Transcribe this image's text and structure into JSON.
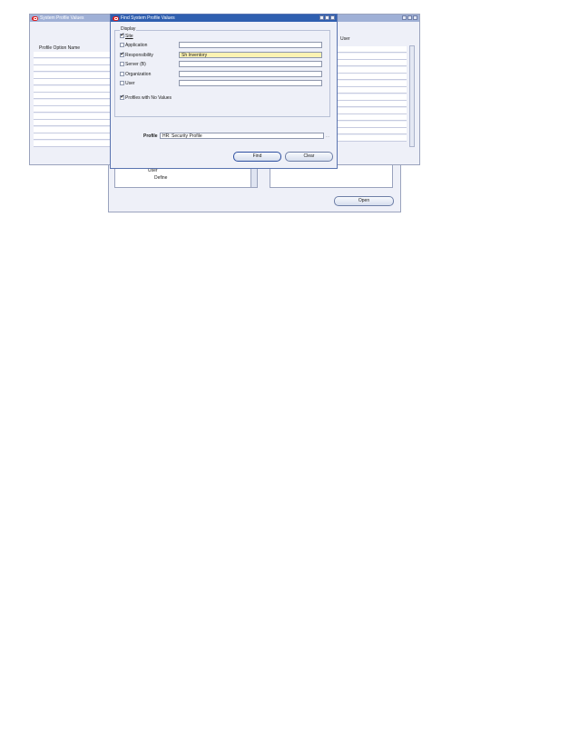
{
  "background_window": {
    "open_label": "Open",
    "tree_items": [
      "User",
      "Define"
    ]
  },
  "profile_values_window": {
    "title": "System Profile Values",
    "column_profile_option_name": "Profile Option Name",
    "column_user": "User"
  },
  "find_window": {
    "title": "Find System Profile Values",
    "display_label": "Display",
    "levels": [
      {
        "label": "Site",
        "checked": true,
        "value": ""
      },
      {
        "label": "Application",
        "checked": false,
        "value": ""
      },
      {
        "label": "Responsibility",
        "checked": true,
        "value": "Sh Inventory"
      },
      {
        "label": "Server (B)",
        "checked": false,
        "value": ""
      },
      {
        "label": "Organization",
        "checked": false,
        "value": ""
      },
      {
        "label": "User",
        "checked": false,
        "value": ""
      }
    ],
    "profiles_no_values_label": "Profiles with No Values",
    "profile_label": "Profile",
    "profile_value": "HR: Security Profile",
    "find_label": "Find",
    "clear_label": "Clear"
  },
  "colors": {
    "title_active": "#2f5fb0",
    "title_inactive": "#9fb0d6",
    "window_bg": "#eef0f8",
    "field_highlight": "#fdf3b3"
  }
}
